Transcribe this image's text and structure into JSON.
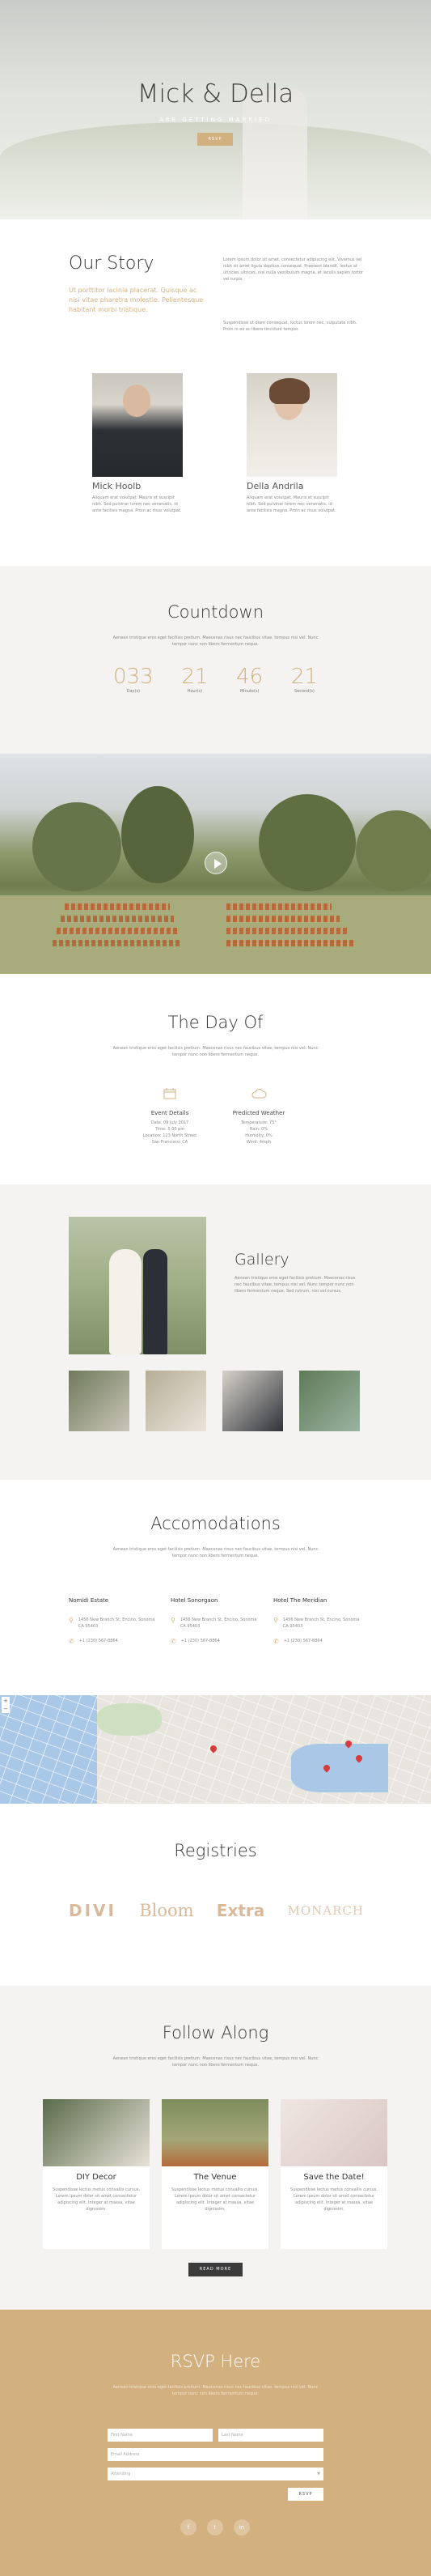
{
  "hero": {
    "title": "Mick & Della",
    "subtitle": "ARE GETTING MARRIED",
    "button": "RSVP"
  },
  "story": {
    "heading": "Our Story",
    "lead": "Ut porttitor lacinia placerat. Quisque ac nisi vitae pharetra molestie. Pellentesque habitant morbi tristique.",
    "body1": "Lorem ipsum dolor sit amet, consectetur adipiscing elit. Vivamus vel nibh sit amet ligula dapibus consequat. Praesent blandit, lectus at ultricies ultrices, nisi nulla vestibulum magna, et iaculis sapien tortor vel turpis.",
    "body2": "Suspendisse ut diam consequat, luctus lorem nec, vulputate nibh. Proin in ex ac libero tincidunt tempor.",
    "person1": {
      "name": "Mick Hoolb",
      "bio": "Aliquam erat volutpat. Mauris et suscipit nibh. Sed pulvinar lorem nec venenatis, id ante facilisis magna. Proin ac risus volutpat."
    },
    "person2": {
      "name": "Della Andrila",
      "bio": "Aliquam erat volutpat. Mauris et suscipit nibh. Sed pulvinar lorem nec venenatis, id ante facilisis magna. Proin ac risus volutpat."
    }
  },
  "countdown": {
    "heading": "Countdown",
    "intro": "Aenean tristique eros eget facilisis pretium. Maecenas risus nec faucibus vitae, tempus nisi vel. Nunc tempor nunc non libero fermentum neque.",
    "units": [
      {
        "value": "033",
        "label": "Day(s)"
      },
      {
        "value": "21",
        "label": "Hour(s)"
      },
      {
        "value": "46",
        "label": "Minute(s)"
      },
      {
        "value": "21",
        "label": "Second(s)"
      }
    ]
  },
  "dayof": {
    "heading": "The Day Of",
    "intro": "Aenean tristique eros eget facilisis pretium. Maecenas risus nec faucibus vitae, tempus nisi vel. Nunc tempor nunc non libero fermentum neque.",
    "event": {
      "title": "Event Details",
      "lines": [
        "Date: 09 July 2017",
        "Time: 5:00 pm",
        "Location: 123 North Street",
        "San Francisco, CA"
      ]
    },
    "weather": {
      "title": "Predicted Weather",
      "lines": [
        "Temperature: 75°",
        "Rain: 0%",
        "Humidity: 0%",
        "Wind: 4mph"
      ]
    }
  },
  "gallery": {
    "heading": "Gallery",
    "text": "Aenean tristique eros eget facilisis pretium. Maecenas risus nec faucibus vitae, tempus nisi vel. Nunc tempor nunc non libero fermentum neque. Sed rutrum, nisi vel cursus."
  },
  "accom": {
    "heading": "Accomodations",
    "intro": "Aenean tristique eros eget facilisis pretium. Maecenas risus nec faucibus vitae, tempus nisi vel. Nunc tempor nunc non libero fermentum neque.",
    "hotels": [
      {
        "name": "Nomidi Estate",
        "address": "1456 New Branch St, Encino, Sonoma CA 95403",
        "phone": "+1 (230) 567-8864"
      },
      {
        "name": "Hotel Sonorgaon",
        "address": "1456 New Branch St, Encino, Sonoma CA 95403",
        "phone": "+1 (230) 567-8864"
      },
      {
        "name": "Hotel The Meridian",
        "address": "1456 New Branch St, Encino, Sonoma CA 95403",
        "phone": "+1 (230) 567-8864"
      }
    ]
  },
  "registries": {
    "heading": "Registries",
    "logos": [
      "DIVI",
      "Bloom",
      "Extra",
      "MONARCH"
    ]
  },
  "follow": {
    "heading": "Follow Along",
    "intro": "Aenean tristique eros eget facilisis pretium. Maecenas risus nec faucibus vitae, tempus nisi vel. Nunc tempor nunc non libero fermentum neque.",
    "cards": [
      {
        "title": "DIY Decor",
        "text": "Suspendisse lectus metus convallis cursus. Lorem ipsum dolor sit amet consectetur adipiscing elit. Integer at massa, vitae dignissim."
      },
      {
        "title": "The Venue",
        "text": "Suspendisse lectus metus convallis cursus. Lorem ipsum dolor sit amet consectetur adipiscing elit. Integer at massa, vitae dignissim."
      },
      {
        "title": "Save the Date!",
        "text": "Suspendisse lectus metus convallis cursus. Lorem ipsum dolor sit amet consectetur adipiscing elit. Integer at massa, vitae dignissim."
      }
    ],
    "button": "READ MORE"
  },
  "rsvp": {
    "heading": "RSVP Here",
    "intro": "Aenean tristique eros eget facilisis pretium. Maecenas risus nec faucibus vitae, tempus nisi vel. Nunc tempor nunc non libero fermentum neque.",
    "first_name": "First Name",
    "last_name": "Last Name",
    "email": "Email Address",
    "attending": "Attending",
    "submit": "RSVP",
    "social": [
      "f",
      "t",
      "in"
    ]
  },
  "map": {
    "zoom_plus": "+",
    "zoom_minus": "−",
    "map_label": "Map"
  },
  "colors": {
    "accent": "#d3b07f",
    "dark": "#333333",
    "light_bg": "#f4f3f2"
  }
}
